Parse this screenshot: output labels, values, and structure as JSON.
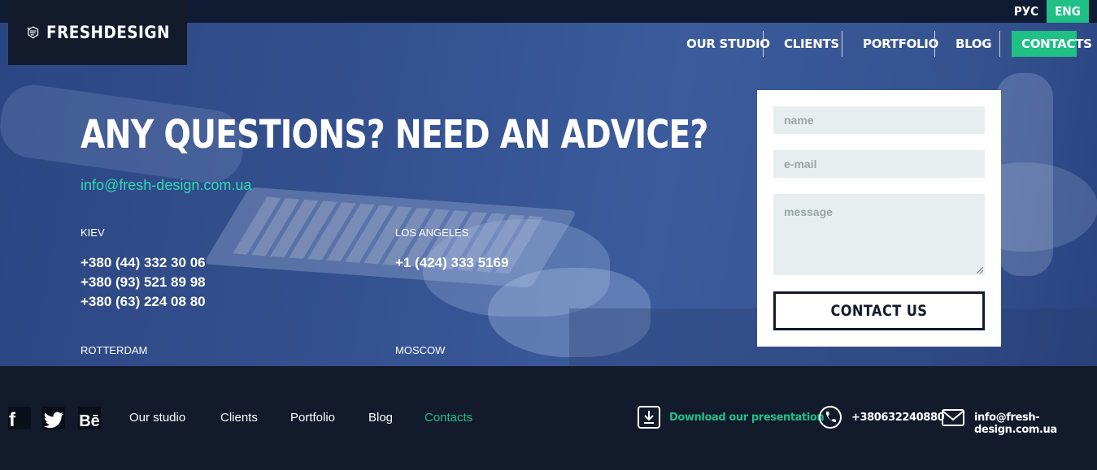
{
  "brand": {
    "name": "FRESHDESIGN"
  },
  "lang": {
    "ru": "РУС",
    "en": "ENG"
  },
  "nav": [
    {
      "label": "OUR STUDIO"
    },
    {
      "label": "CLIENTS"
    },
    {
      "label": "PORTFOLIO"
    },
    {
      "label": "BLOG"
    },
    {
      "label": "CONTACTS"
    }
  ],
  "hero": {
    "headline": "ANY QUESTIONS? NEED AN ADVICE?",
    "email": "info@fresh-design.com.ua"
  },
  "offices": {
    "kiev": {
      "city": "KIEV",
      "phones": [
        "+380 (44) 332 30 06",
        "+380 (93) 521 89 98",
        "+380 (63) 224 08 80"
      ]
    },
    "la": {
      "city": "LOS ANGELES",
      "phones": [
        "+1 (424) 333 5169"
      ]
    },
    "rotterdam": {
      "city": "ROTTERDAM"
    },
    "moscow": {
      "city": "MOSCOW"
    }
  },
  "form": {
    "name_placeholder": "name",
    "email_placeholder": "e-mail",
    "message_placeholder": "message",
    "submit_label": "CONTACT US"
  },
  "footer": {
    "social": {
      "fb": "f",
      "be": "Bē"
    },
    "nav": [
      "Our studio",
      "Clients",
      "Portfolio",
      "Blog",
      "Contacts"
    ],
    "download_label": "Download our presentation",
    "phone": "+380632240880",
    "email": "info@fresh-design.com.ua"
  },
  "colors": {
    "accent": "#1fbf86",
    "dark": "#121a2c",
    "email_link": "#32d9b8",
    "hero_blue": "#34518f"
  }
}
